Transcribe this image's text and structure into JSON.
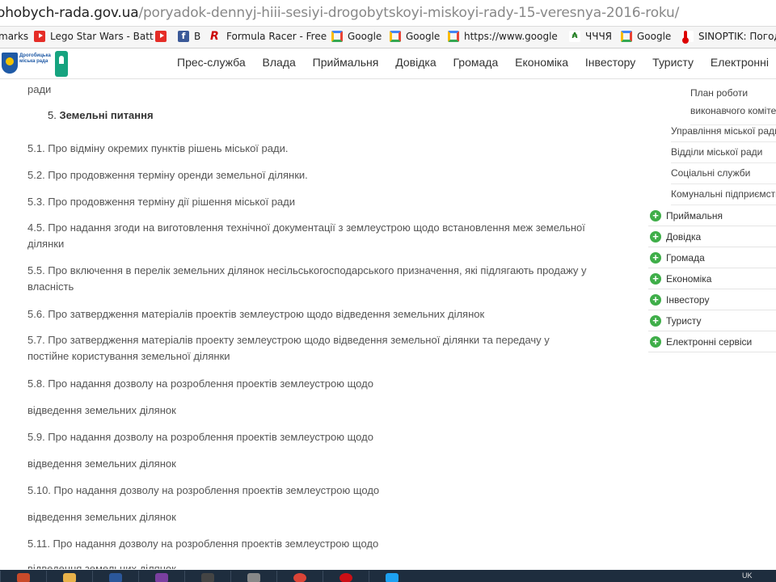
{
  "browser": {
    "url_host": "ohobych-rada.gov.ua",
    "url_path": "/poryadok-dennyj-hiii-sesiyi-drogobytskoyi-miskoyi-rady-15-veresnya-2016-roku/",
    "bookmarks": [
      {
        "label": "marks",
        "icon": ""
      },
      {
        "label": "Lego Star Wars - Batt",
        "icon": "youtube-icon"
      },
      {
        "label": "",
        "icon": "youtube-icon"
      },
      {
        "label": "B",
        "icon": "facebook-icon"
      },
      {
        "label": "Formula Racer - Free",
        "icon": "formula-racer-icon"
      },
      {
        "label": "Google",
        "icon": "google-icon"
      },
      {
        "label": "Google",
        "icon": "google-icon"
      },
      {
        "label": "https://www.google.c",
        "icon": "google-icon"
      },
      {
        "label": "ЧЧЧЯ",
        "icon": "chchch-icon"
      },
      {
        "label": "Google",
        "icon": "google-icon"
      },
      {
        "label": "SINOPTIK: Погода",
        "icon": "sinoptik-icon"
      }
    ]
  },
  "site": {
    "logo_text": "Дрогобицька міська рада",
    "nav": [
      "Прес-служба",
      "Влада",
      "Приймальня",
      "Довідка",
      "Громада",
      "Економіка",
      "Інвестору",
      "Туристу",
      "Електронні"
    ]
  },
  "content": {
    "top_cut": "…",
    "top_line": "ради",
    "section_number": "5.",
    "section_title": "Земельні питання",
    "items": [
      "5.1. Про  відміну окремих пунктів  рішень міської ради.",
      "5.2. Про продовження терміну оренди  земельної ділянки.",
      "5.3. Про продовження терміну дії рішення міської ради",
      "4.5. Про надання згоди на виготовлення технічної документації з землеустрою щодо встановлення меж земельної ділянки",
      "5.5. Про включення в перелік земельних ділянок несільськогосподарського призначення,  які підлягають продажу у власність",
      "5.6. Про затвердження матеріалів проектів землеустрою щодо  відведення земельних ділянок",
      "5.7. Про затвердження матеріалів проекту землеустрою щодо відведення земельної ділянки та передачу у постійне користування земельної ділянки",
      "5.8. Про надання дозволу на розроблення проектів землеустрою щодо",
      "відведення земельних ділянок",
      "5.9. Про надання дозволу на розроблення проектів землеустрою щодо",
      "відведення земельних ділянок",
      "5.10. Про надання дозволу на розроблення проектів землеустрою щодо",
      "відведення земельних ділянок",
      "5.11. Про надання дозволу на розроблення проектів землеустрою щодо",
      "відведення земельних ділянок"
    ]
  },
  "sidebar": {
    "sub_items": [
      "План роботи виконавчого комітету",
      "Управління міської ради",
      "Відділи міської ради",
      "Соціальні служби",
      "Комунальні підприємства"
    ],
    "items": [
      "Приймальня",
      "Довідка",
      "Громада",
      "Економіка",
      "Інвестору",
      "Туристу",
      "Електронні сервіси"
    ]
  },
  "taskbar": {
    "tray_text": "UK"
  },
  "colors": {
    "accent_green": "#3fae49",
    "taskbar": "#1e2d3e",
    "text": "#555555"
  }
}
